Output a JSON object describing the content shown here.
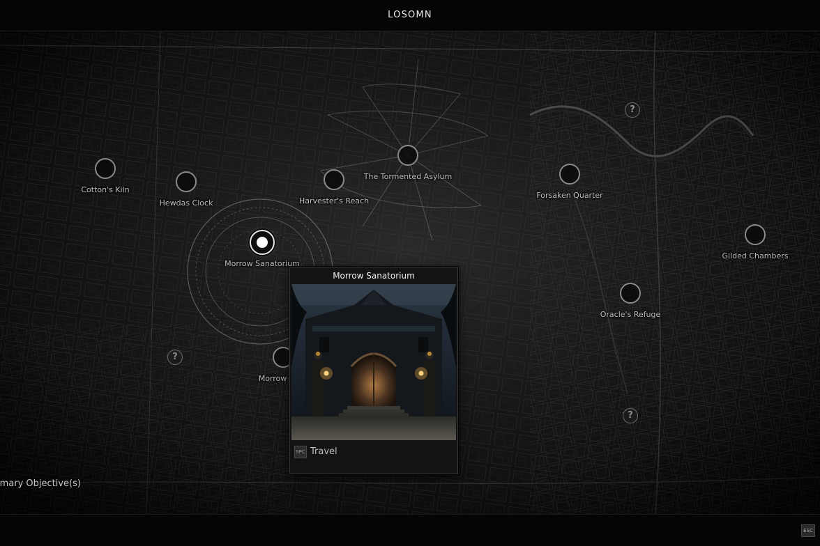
{
  "header": {
    "region_title": "LOSOMN"
  },
  "map": {
    "locations": [
      {
        "label": "Cotton's Kiln"
      },
      {
        "label": "Hewdas Clock"
      },
      {
        "label": "Harvester's Reach"
      },
      {
        "label": "The Tormented Asylum"
      },
      {
        "label": "Forsaken Quarter"
      },
      {
        "label": "Gilded Chambers"
      },
      {
        "label": "Morrow Sanatorium"
      },
      {
        "label": "Oracle's Refuge"
      },
      {
        "label": "Morrow"
      }
    ],
    "unknown_marker_glyph": "?"
  },
  "popup": {
    "title": "Morrow Sanatorium",
    "key_hint": "SPC",
    "action_label": "Travel"
  },
  "objectives": {
    "label": "imary Objective(s)"
  },
  "footer": {
    "close_key": "ESC"
  },
  "colors": {
    "background": "#101010",
    "bar": "#050505",
    "node_border": "#8a8a8a",
    "selected_node": "#ffffff",
    "label_text": "#bdbdbd"
  },
  "icons": {
    "location_node": "location-node-icon",
    "selected_node": "selected-location-icon",
    "unknown": "question-mark-icon"
  }
}
